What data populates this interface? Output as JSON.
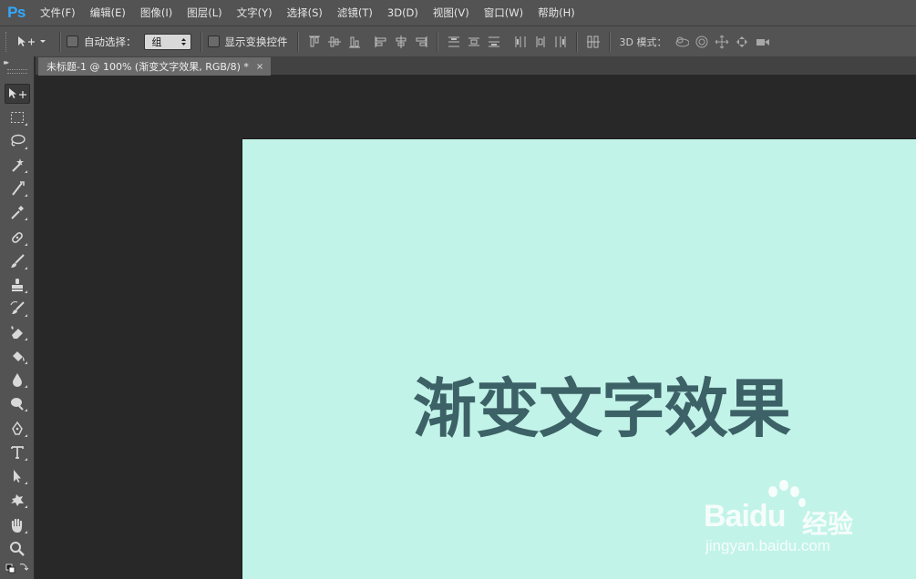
{
  "app": {
    "logo": "Ps"
  },
  "menu": [
    {
      "label": "文件(F)"
    },
    {
      "label": "编辑(E)"
    },
    {
      "label": "图像(I)"
    },
    {
      "label": "图层(L)"
    },
    {
      "label": "文字(Y)"
    },
    {
      "label": "选择(S)"
    },
    {
      "label": "滤镜(T)"
    },
    {
      "label": "3D(D)"
    },
    {
      "label": "视图(V)"
    },
    {
      "label": "窗口(W)"
    },
    {
      "label": "帮助(H)"
    }
  ],
  "options": {
    "auto_select_label": "自动选择：",
    "auto_select_value": "组",
    "show_transform_label": "显示变换控件",
    "mode_3d_label": "3D 模式："
  },
  "document": {
    "tab_title": "未标题-1 @ 100% (渐变文字效果, RGB/8) *",
    "tab_close": "×",
    "text": "渐变文字效果",
    "background_color": "#c2f3e8",
    "text_color": "#3c6166"
  },
  "watermark": {
    "brand": "Bai",
    "brand2": "du",
    "suffix": "经验",
    "url": "jingyan.baidu.com"
  }
}
